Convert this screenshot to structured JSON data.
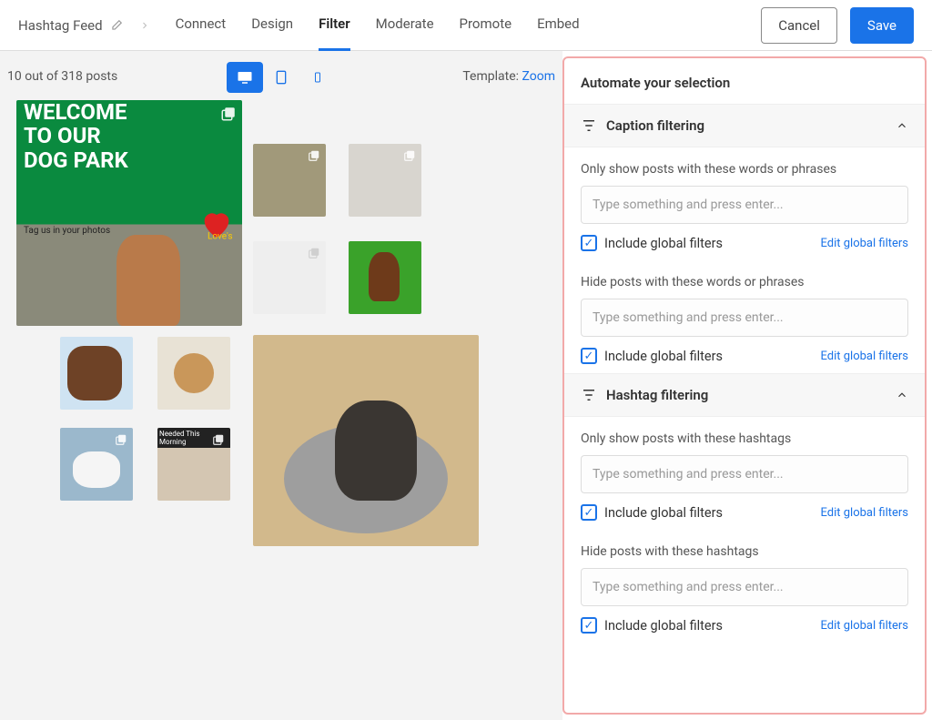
{
  "header": {
    "feed_title": "Hashtag Feed",
    "tabs": [
      "Connect",
      "Design",
      "Filter",
      "Moderate",
      "Promote",
      "Embed"
    ],
    "active_tab": "Filter",
    "cancel": "Cancel",
    "save": "Save"
  },
  "preview": {
    "post_count": "10 out of 318 posts",
    "template_label": "Template:",
    "template_value": "Zoom",
    "big_post_line1": "WELCOME",
    "big_post_line2": "TO OUR",
    "big_post_line3": "DOG PARK",
    "big_post_tag": "Tag us in your photos",
    "post9_overlay": "Needed This Morning"
  },
  "sidebar": {
    "automate_title": "Automate your selection",
    "sections": {
      "caption": {
        "title": "Caption filtering",
        "show_label": "Only show posts with these words or phrases",
        "hide_label": "Hide posts with these words or phrases",
        "placeholder": "Type something and press enter...",
        "include_label": "Include global filters",
        "edit_link": "Edit global filters"
      },
      "hashtag": {
        "title": "Hashtag filtering",
        "show_label": "Only show posts with these hashtags",
        "hide_label": "Hide posts with these hashtags",
        "placeholder": "Type something and press enter...",
        "include_label": "Include global filters",
        "edit_link": "Edit global filters"
      }
    }
  }
}
